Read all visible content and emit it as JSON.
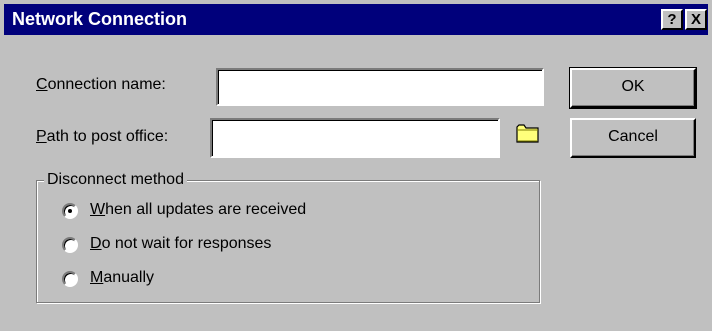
{
  "window": {
    "title": "Network Connection",
    "help_label": "?",
    "close_label": "X"
  },
  "form": {
    "connection_name": {
      "label_access": "C",
      "label_rest": "onnection name:",
      "value": ""
    },
    "post_office_path": {
      "label_access": "P",
      "label_rest": "ath to post office:",
      "value": ""
    },
    "browse_icon": "folder-icon"
  },
  "buttons": {
    "ok": "OK",
    "cancel": "Cancel"
  },
  "disconnect_method": {
    "legend": "Disconnect method",
    "options": [
      {
        "access": "W",
        "rest": "hen all updates are received",
        "selected": true
      },
      {
        "access": "D",
        "rest": "o not wait for responses",
        "selected": false
      },
      {
        "access": "M",
        "rest": "anually",
        "selected": false
      }
    ]
  }
}
